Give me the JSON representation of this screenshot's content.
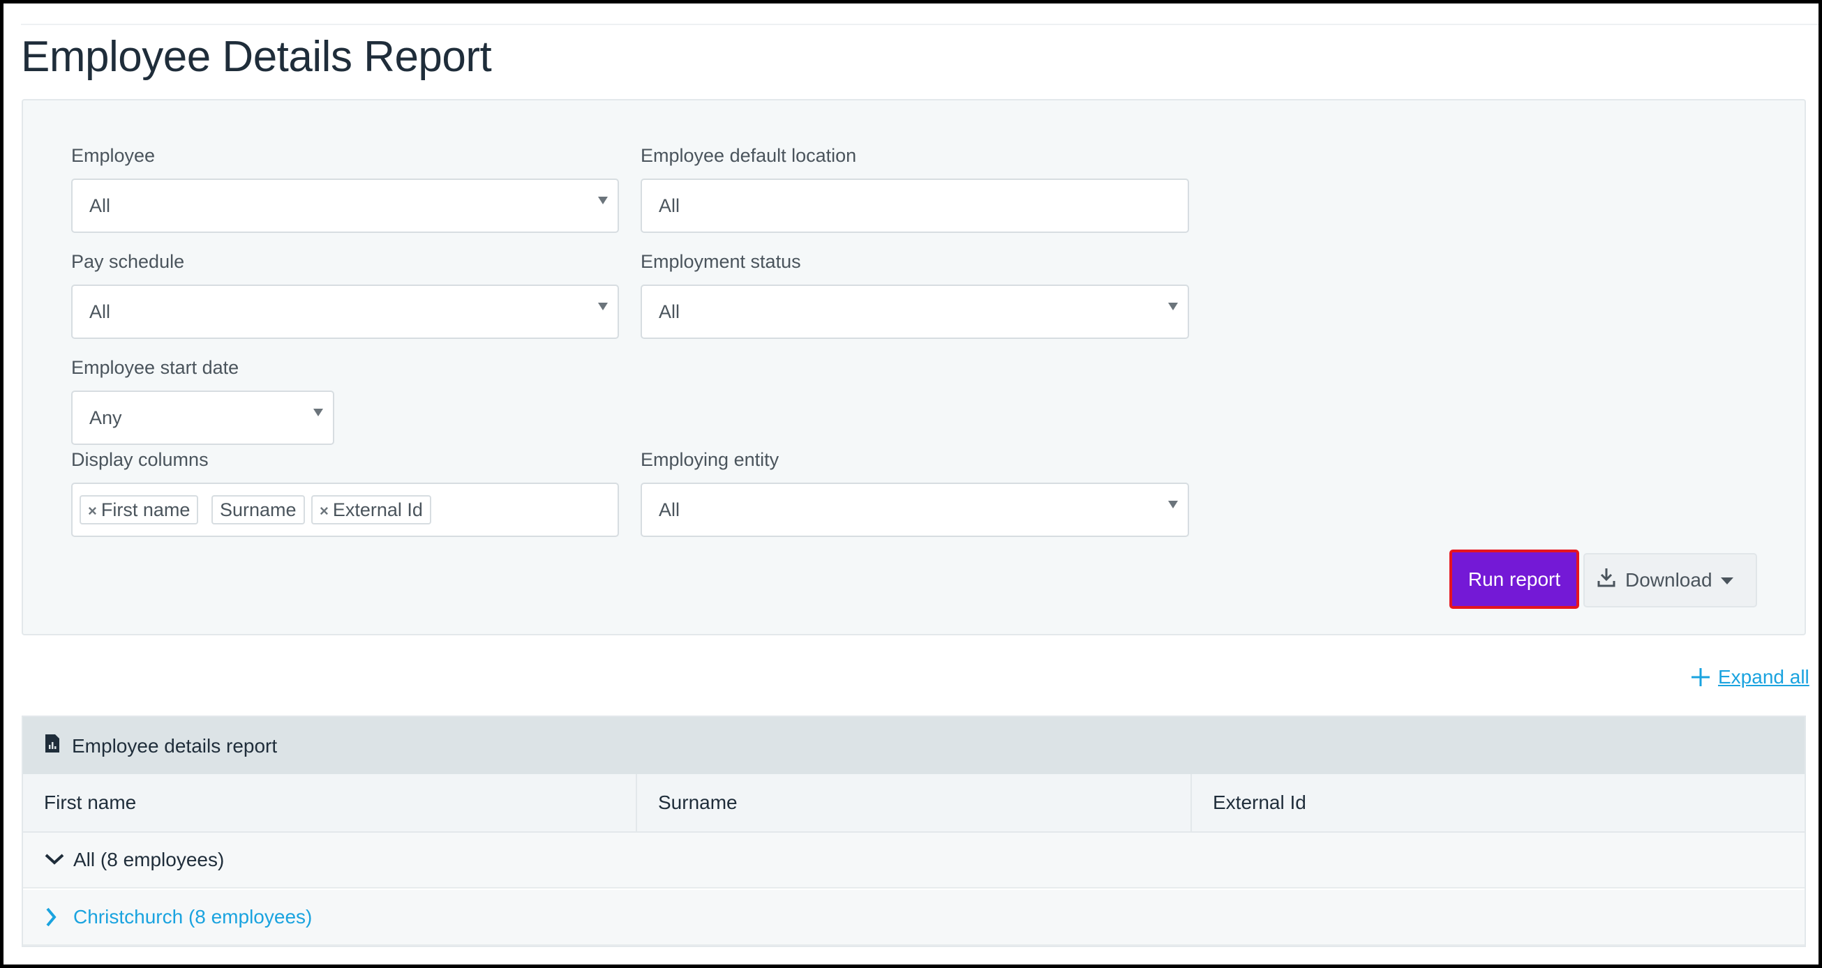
{
  "page": {
    "title": "Employee Details Report"
  },
  "filters": {
    "employee": {
      "label": "Employee",
      "value": "All"
    },
    "default_location": {
      "label": "Employee default location",
      "value": "All"
    },
    "pay_schedule": {
      "label": "Pay schedule",
      "value": "All"
    },
    "employment_status": {
      "label": "Employment status",
      "value": "All"
    },
    "start_date": {
      "label": "Employee start date",
      "value": "Any"
    },
    "display_columns": {
      "label": "Display columns",
      "tags": [
        {
          "text": "First name",
          "removable": true
        },
        {
          "text": "Surname",
          "removable": false
        },
        {
          "text": "External Id",
          "removable": true
        }
      ],
      "remove_glyph": "×"
    },
    "employing_entity": {
      "label": "Employing entity",
      "value": "All"
    }
  },
  "actions": {
    "run_label": "Run report",
    "download_label": "Download",
    "download_icon": "download-icon",
    "expand_all_label": "Expand all",
    "expand_icon": "plus-icon"
  },
  "report": {
    "title": "Employee details report",
    "title_icon": "report-doc-icon",
    "columns": [
      "First name",
      "Surname",
      "External Id"
    ],
    "groups": [
      {
        "label": "All (8 employees)",
        "expanded": true,
        "icon": "chevron-down-icon"
      },
      {
        "label": "Christchurch (8 employees)",
        "expanded": false,
        "icon": "chevron-right-icon"
      }
    ]
  },
  "colors": {
    "accent_purple": "#7419d6",
    "highlight_border": "#e5151f",
    "link_blue": "#1aa3df",
    "panel_bg": "#f5f8f9",
    "report_header_bg": "#dce3e6"
  }
}
